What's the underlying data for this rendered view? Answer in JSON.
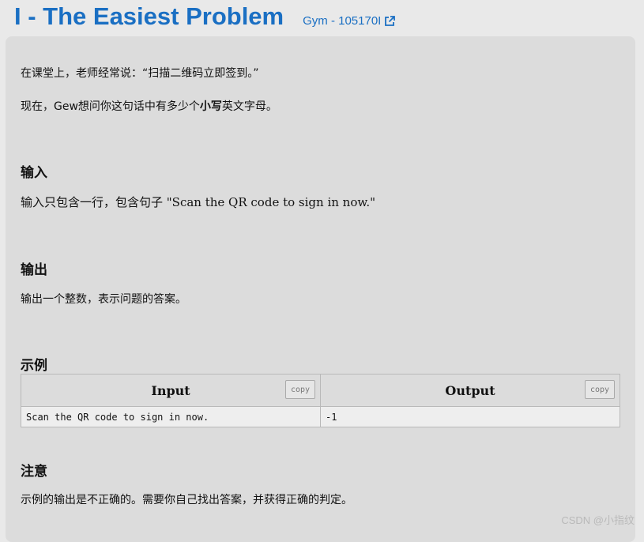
{
  "header": {
    "title": "I - The Easiest Problem",
    "gym_label": "Gym - 105170I"
  },
  "statement": {
    "line1": "在课堂上，老师经常说：“扫描二维码立即签到。”",
    "line2_before": "现在，Gew想问你这句话中有多少个",
    "line2_bold": "小写",
    "line2_after": "英文字母。"
  },
  "input_section": {
    "heading": "输入",
    "text": "输入只包含一行，包含句子 \"Scan the QR code to sign in now.\""
  },
  "output_section": {
    "heading": "输出",
    "text": "输出一个整数，表示问题的答案。"
  },
  "example_section": {
    "heading": "示例",
    "input_header": "Input",
    "output_header": "Output",
    "copy_label": "copy",
    "input_value": "Scan the QR code to sign in now.",
    "output_value": "-1"
  },
  "note_section": {
    "heading": "注意",
    "text": "示例的输出是不正确的。需要你自己找出答案，并获得正确的判定。"
  },
  "watermark": "CSDN @小指纹",
  "colors": {
    "link": "#1a6fc3",
    "card_bg": "#dcdcdc",
    "page_bg": "#e9e9e9"
  },
  "icons": {
    "external_link": "external-link-icon"
  }
}
